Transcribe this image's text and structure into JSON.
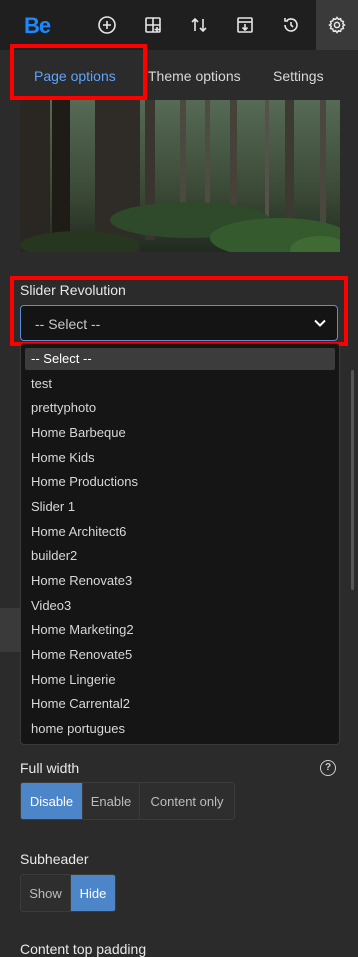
{
  "app": {
    "logo": "Be"
  },
  "toolbar": {
    "icons": [
      "add-circle-icon",
      "add-section-icon",
      "sort-icon",
      "export-icon",
      "history-icon",
      "settings-icon"
    ]
  },
  "tabs": [
    {
      "label": "Page options",
      "active": true
    },
    {
      "label": "Theme options",
      "active": false
    },
    {
      "label": "Settings",
      "active": false
    }
  ],
  "slider": {
    "label": "Slider Revolution",
    "selected": "-- Select --",
    "options": [
      "-- Select --",
      "test",
      "prettyphoto",
      "Home Barbeque",
      "Home Kids",
      "Home Productions",
      "Slider 1",
      "Home Architect6",
      "builder2",
      "Home Renovate3",
      "Video3",
      "Home Marketing2",
      "Home Renovate5",
      "Home Lingerie",
      "Home Carrental2",
      "home portugues"
    ]
  },
  "full_width": {
    "label": "Full width",
    "options": [
      "Disable",
      "Enable",
      "Content only"
    ],
    "selected": "Disable"
  },
  "subheader": {
    "label": "Subheader",
    "options": [
      "Show",
      "Hide"
    ],
    "selected": "Hide"
  },
  "content_top_padding": {
    "label": "Content top padding"
  },
  "colors": {
    "accent": "#5fa3ff",
    "toggle_on": "#4c86c9",
    "highlight": "#ff0000",
    "logo": "#1e88ff"
  }
}
